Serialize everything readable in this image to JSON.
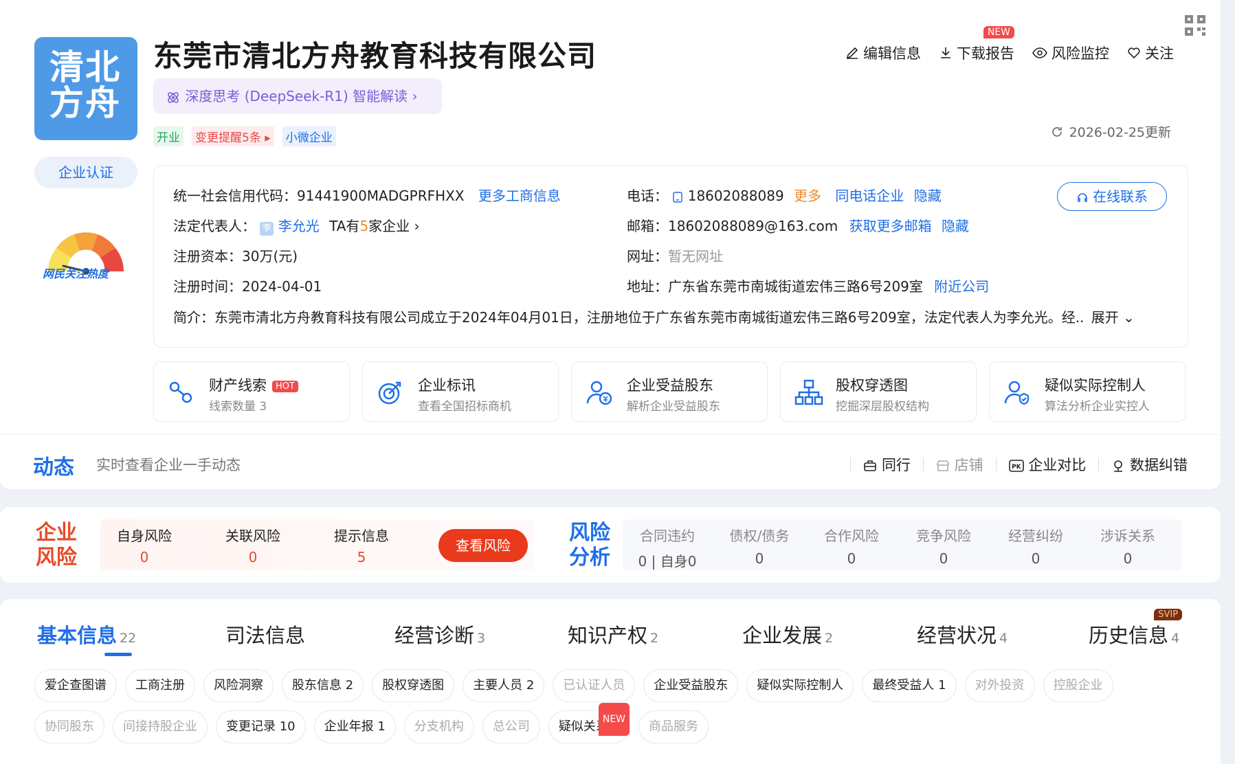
{
  "company": {
    "logo_text_line1": "清北",
    "logo_text_line2": "方舟",
    "name": "东莞市清北方舟教育科技有限公司",
    "ai_read": "深度思考 (DeepSeek-R1) 智能解读",
    "cert_button": "企业认证",
    "heat_label": "网民关注热度",
    "tags": [
      "开业",
      "变更提醒5条",
      "小微企业"
    ]
  },
  "actions": {
    "edit": "编辑信息",
    "download": "下载报告",
    "download_badge": "NEW",
    "monitor": "风险监控",
    "follow": "关注"
  },
  "update_text": "2026-02-25更新",
  "info": {
    "credit_code_label": "统一社会信用代码：",
    "credit_code": "91441900MADGPRFHXX",
    "more_biz": "更多工商信息",
    "legal_label": "法定代表人：",
    "legal_avatar": "李",
    "legal_name": "李允光",
    "legal_ta": "TA有",
    "legal_count": "5",
    "legal_suffix": "家企业",
    "capital_label": "注册资本：",
    "capital": "30万(元)",
    "reg_time_label": "注册时间：",
    "reg_time": "2024-04-01",
    "phone_label": "电话：",
    "phone": "18602088089",
    "phone_more": "更多",
    "same_phone": "同电话企业",
    "hide1": "隐藏",
    "email_label": "邮箱：",
    "email": "18602088089@163.com",
    "more_email": "获取更多邮箱",
    "hide2": "隐藏",
    "website_label": "网址：",
    "website": "暂无网址",
    "address_label": "地址：",
    "address": "广东省东莞市南城街道宏伟三路6号209室",
    "nearby": "附近公司",
    "intro_label": "简介：",
    "intro": "东莞市清北方舟教育科技有限公司成立于2024年04月01日，注册地位于广东省东莞市南城街道宏伟三路6号209室，法定代表人为李允光。经..",
    "expand": "展开",
    "online_contact": "在线联系"
  },
  "features": [
    {
      "title": "财产线索",
      "badge": "HOT",
      "sub": "线索数量 3",
      "icon": "asset-clue-icon"
    },
    {
      "title": "企业标讯",
      "badge": "",
      "sub": "查看全国招标商机",
      "icon": "target-icon"
    },
    {
      "title": "企业受益股东",
      "badge": "",
      "sub": "解析企业受益股东",
      "icon": "beneficiary-icon"
    },
    {
      "title": "股权穿透图",
      "badge": "",
      "sub": "挖掘深层股权结构",
      "icon": "org-chart-icon"
    },
    {
      "title": "疑似实际控制人",
      "badge": "",
      "sub": "算法分析企业实控人",
      "icon": "controller-icon"
    }
  ],
  "dynamics": {
    "title": "动态",
    "subtitle": "实时查看企业一手动态",
    "peer": "同行",
    "store": "店铺",
    "compare": "企业对比",
    "correct": "数据纠错"
  },
  "risk": {
    "label_line1": "企业",
    "label_line2": "风险",
    "items": [
      {
        "label": "自身风险",
        "value": "0"
      },
      {
        "label": "关联风险",
        "value": "0"
      },
      {
        "label": "提示信息",
        "value": "5"
      }
    ],
    "view_button": "查看风险",
    "analysis_line1": "风险",
    "analysis_line2": "分析",
    "analysis": [
      {
        "label": "合同违约",
        "value": "0 | 自身0"
      },
      {
        "label": "债权/债务",
        "value": "0"
      },
      {
        "label": "合作风险",
        "value": "0"
      },
      {
        "label": "竞争风险",
        "value": "0"
      },
      {
        "label": "经营纠纷",
        "value": "0"
      },
      {
        "label": "涉诉关系",
        "value": "0"
      }
    ]
  },
  "tabs": [
    {
      "label": "基本信息",
      "count": "22"
    },
    {
      "label": "司法信息",
      "count": ""
    },
    {
      "label": "经营诊断",
      "count": "3"
    },
    {
      "label": "知识产权",
      "count": "2"
    },
    {
      "label": "企业发展",
      "count": "2"
    },
    {
      "label": "经营状况",
      "count": "4"
    },
    {
      "label": "历史信息",
      "count": "4"
    }
  ],
  "svip_badge": "SVIP",
  "chips_row1": [
    "爱企查图谱",
    "工商注册",
    "风险洞察",
    "股东信息 2",
    "股权穿透图",
    "主要人员 2",
    "已认证人员",
    "企业受益股东",
    "疑似实际控制人",
    "最终受益人 1",
    "对外投资",
    "控股企业"
  ],
  "chips_row2": [
    "协同股东",
    "间接持股企业",
    "变更记录 10",
    "企业年报 1",
    "分支机构",
    "总公司",
    "疑似关系 6",
    "商品服务"
  ],
  "chip_new_badge": "NEW"
}
